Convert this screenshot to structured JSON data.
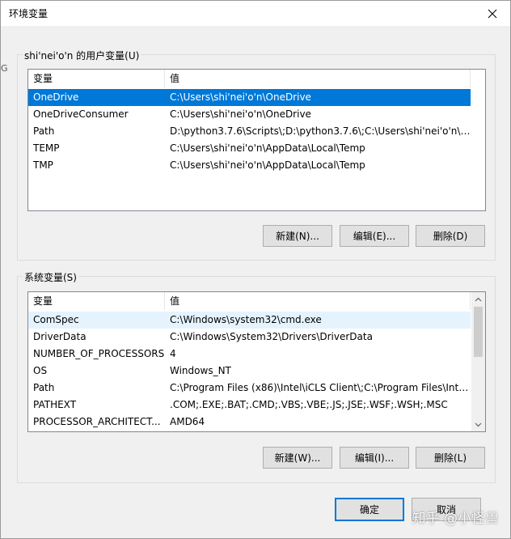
{
  "window": {
    "title": "环境变量"
  },
  "user_vars": {
    "group_label": "shi'nei'o'n 的用户变量(U)",
    "columns": [
      "变量",
      "值"
    ],
    "rows": [
      {
        "name": "OneDrive",
        "value": "C:\\Users\\shi'nei'o'n\\OneDrive",
        "selected": true
      },
      {
        "name": "OneDriveConsumer",
        "value": "C:\\Users\\shi'nei'o'n\\OneDrive"
      },
      {
        "name": "Path",
        "value": "D:\\python3.7.6\\Scripts\\;D:\\python3.7.6\\;C:\\Users\\shi'nei'o'n\\A..."
      },
      {
        "name": "TEMP",
        "value": "C:\\Users\\shi'nei'o'n\\AppData\\Local\\Temp"
      },
      {
        "name": "TMP",
        "value": "C:\\Users\\shi'nei'o'n\\AppData\\Local\\Temp"
      }
    ],
    "buttons": {
      "new": "新建(N)...",
      "edit": "编辑(E)...",
      "delete": "删除(D)"
    }
  },
  "system_vars": {
    "group_label": "系统变量(S)",
    "columns": [
      "变量",
      "值"
    ],
    "rows": [
      {
        "name": "ComSpec",
        "value": "C:\\Windows\\system32\\cmd.exe",
        "hover": true
      },
      {
        "name": "DriverData",
        "value": "C:\\Windows\\System32\\Drivers\\DriverData"
      },
      {
        "name": "NUMBER_OF_PROCESSORS",
        "value": "4"
      },
      {
        "name": "OS",
        "value": "Windows_NT"
      },
      {
        "name": "Path",
        "value": "C:\\Program Files (x86)\\Intel\\iCLS Client\\;C:\\Program Files\\Intel..."
      },
      {
        "name": "PATHEXT",
        "value": ".COM;.EXE;.BAT;.CMD;.VBS;.VBE;.JS;.JSE;.WSF;.WSH;.MSC"
      },
      {
        "name": "PROCESSOR_ARCHITECT...",
        "value": "AMD64"
      }
    ],
    "buttons": {
      "new": "新建(W)...",
      "edit": "编辑(I)...",
      "delete": "删除(L)"
    }
  },
  "footer": {
    "ok": "确定",
    "cancel": "取消"
  },
  "watermark": "知乎 @小怪兽",
  "edge_glyph": "G",
  "colors": {
    "selection": "#0078d7",
    "hover_row": "#e5f3ff",
    "dialog_bg": "#f0f0f0"
  },
  "icons": {
    "close": "close-icon",
    "scroll_up": "chevron-up-icon",
    "scroll_down": "chevron-down-icon"
  }
}
